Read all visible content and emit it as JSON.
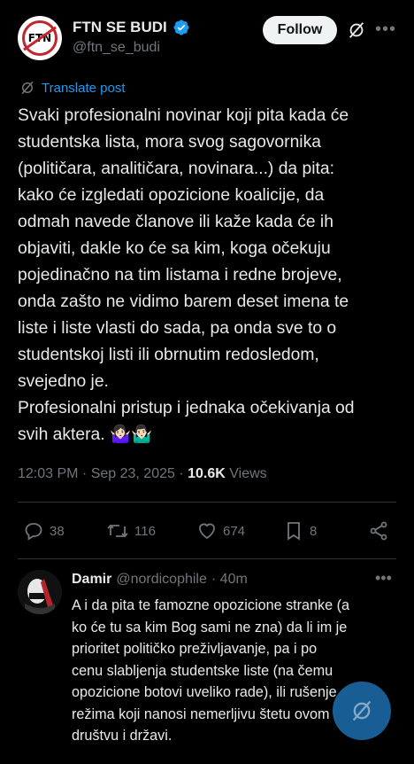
{
  "post": {
    "display_name": "FTN SE BUDI",
    "handle": "@ftn_se_budi",
    "avatar_text": "FTN",
    "follow_label": "Follow",
    "translate_label": "Translate post",
    "text": "Svaki profesionalni novinar koji pita kada će\nstudentska lista, mora svog sagovornika\n(političara, analitičara, novinara...) da pita:\nkako će izgledati opozicione koalicije, da\nodmah navede članove ili kaže kada će ih\nobjaviti, dakle ko će sa kim, koga očekuju\npojedinačno na tim listama i redne brojeve,\nonda zašto ne vidimo barem deset imena te\nliste i liste vlasti do sada, pa onda sve to o\nstudentskoj listi ili obrnutim redosledom,\nsvejedno je.\nProfesionalni pristup i jednaka očekivanja od\nsvih aktera. 🤷🏻‍♀️🤷🏻‍♂️",
    "time": "12:03 PM · Sep 23, 2025 · ",
    "views_count": "10.6K",
    "views_label": " Views",
    "replies": "38",
    "reposts": "116",
    "likes": "674",
    "bookmarks": "8"
  },
  "reply": {
    "name": "Damir",
    "handle": "@nordicophile",
    "time": "· 40m",
    "text": "A i da pita te famozne opozicione stranke (a\nko će tu sa kim Bog sami ne zna) da li im je\nprioritet političko preživljavanje, pa i po\ncenu slabljenja studentske liste (na čemu\nopozicione botovi uveliko rade), ili rušenje\nrežima koji nanosi nemerljivu štetu ovom\ndruštvu i državi."
  },
  "colors": {
    "accent": "#1d9bf0",
    "muted": "#71767b",
    "background": "#000000",
    "text": "#e7e9ea"
  },
  "icons": [
    "verified-badge-icon",
    "grok-icon",
    "more-icon",
    "translate-icon",
    "reply-icon",
    "retweet-icon",
    "like-icon",
    "bookmark-icon",
    "share-icon",
    "compose-fab-icon"
  ]
}
